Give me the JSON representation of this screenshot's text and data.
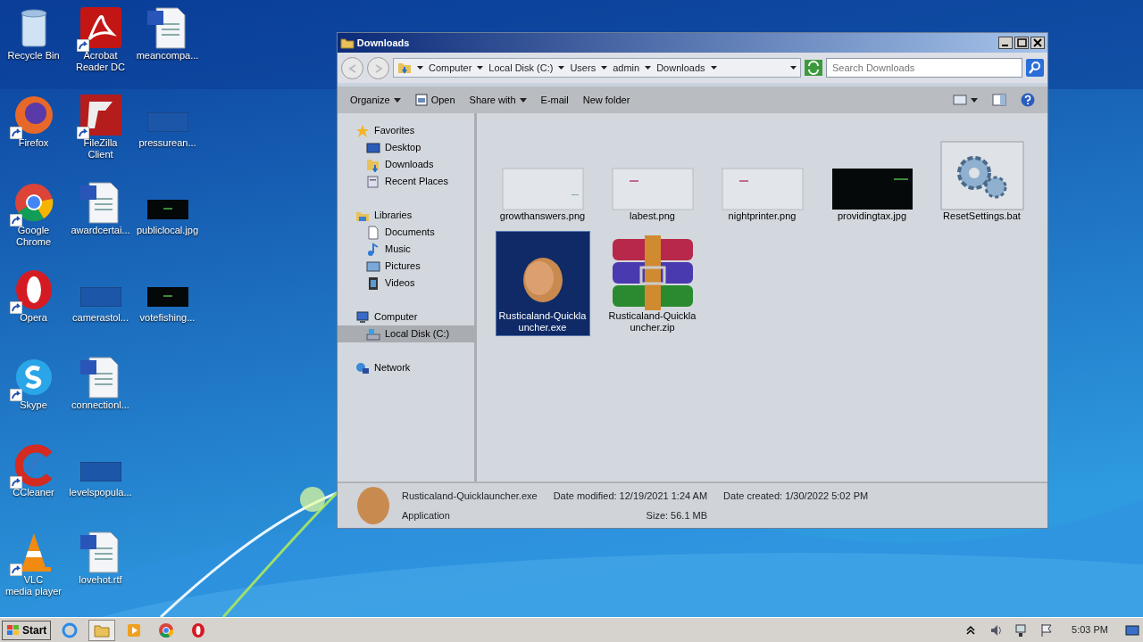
{
  "desktop": {
    "columns": [
      [
        {
          "label": "Recycle Bin",
          "kind": "recycle",
          "shortcut": false
        },
        {
          "label": "Firefox",
          "kind": "firefox",
          "shortcut": true
        },
        {
          "label": "Google Chrome",
          "kind": "chrome",
          "shortcut": true
        },
        {
          "label": "Opera",
          "kind": "opera",
          "shortcut": true
        },
        {
          "label": "Skype",
          "kind": "skype",
          "shortcut": true
        },
        {
          "label": "CCleaner",
          "kind": "ccleaner",
          "shortcut": true
        },
        {
          "label": "VLC media player",
          "kind": "vlc",
          "shortcut": true
        }
      ],
      [
        {
          "label": "Acrobat Reader DC",
          "kind": "acrobat",
          "shortcut": true
        },
        {
          "label": "FileZilla Client",
          "kind": "filezilla",
          "shortcut": true
        },
        {
          "label": "awardcertai...",
          "kind": "word",
          "shortcut": false
        },
        {
          "label": "camerastol...",
          "kind": "blank",
          "shortcut": false
        },
        {
          "label": "connectionl...",
          "kind": "word",
          "shortcut": false
        },
        {
          "label": "levelspopula...",
          "kind": "blank",
          "shortcut": false
        },
        {
          "label": "lovehot.rtf",
          "kind": "word",
          "shortcut": false
        }
      ],
      [
        {
          "label": "meancompa...",
          "kind": "word",
          "shortcut": false
        },
        {
          "label": "pressurean...",
          "kind": "blank",
          "shortcut": false
        },
        {
          "label": "publiclocal.jpg",
          "kind": "dark",
          "shortcut": false
        },
        {
          "label": "votefishing...",
          "kind": "dark",
          "shortcut": false
        }
      ]
    ]
  },
  "window": {
    "title": "Downloads",
    "address": [
      "Computer",
      "Local Disk (C:)",
      "Users",
      "admin",
      "Downloads"
    ],
    "search": {
      "placeholder": "Search Downloads"
    },
    "toolbar": [
      {
        "label": "Organize",
        "dropdown": true,
        "kind": "menu"
      },
      {
        "label": "Open",
        "dropdown": false,
        "kind": "open"
      },
      {
        "label": "Share with",
        "dropdown": true,
        "kind": "menu"
      },
      {
        "label": "E-mail",
        "dropdown": false,
        "kind": "plain"
      },
      {
        "label": "New folder",
        "dropdown": false,
        "kind": "plain"
      }
    ],
    "nav": [
      {
        "label": "Favorites",
        "kind": "star",
        "selected": false,
        "children": [
          {
            "label": "Desktop",
            "kind": "desktop",
            "selected": false
          },
          {
            "label": "Downloads",
            "kind": "downloads",
            "selected": false
          },
          {
            "label": "Recent Places",
            "kind": "recent",
            "selected": false
          }
        ]
      },
      {
        "label": "Libraries",
        "kind": "library",
        "selected": false,
        "children": [
          {
            "label": "Documents",
            "kind": "doc",
            "selected": false
          },
          {
            "label": "Music",
            "kind": "music",
            "selected": false
          },
          {
            "label": "Pictures",
            "kind": "pictures",
            "selected": false
          },
          {
            "label": "Videos",
            "kind": "videos",
            "selected": false
          }
        ]
      },
      {
        "label": "Computer",
        "kind": "computer",
        "selected": false,
        "children": [
          {
            "label": "Local Disk (C:)",
            "kind": "disk",
            "selected": true
          }
        ]
      },
      {
        "label": "Network",
        "kind": "network",
        "selected": false
      }
    ],
    "files": [
      {
        "name": "growthanswers.png",
        "kind": "light",
        "selected": false
      },
      {
        "name": "labest.png",
        "kind": "pink",
        "selected": false
      },
      {
        "name": "nightprinter.png",
        "kind": "pink",
        "selected": false
      },
      {
        "name": "providingtax.jpg",
        "kind": "dark",
        "selected": false
      },
      {
        "name": "ResetSettings.bat",
        "kind": "gear",
        "selected": false
      },
      {
        "name": "Rusticaland-Quicklauncher.exe",
        "kind": "exe",
        "selected": true
      },
      {
        "name": "Rusticaland-Quicklauncher.zip",
        "kind": "archive",
        "selected": false
      }
    ],
    "details": {
      "name": "Rusticaland-Quicklauncher.exe",
      "type": "Application",
      "modified_label": "Date modified:",
      "modified": "12/19/2021 1:24 AM",
      "size_label": "Size:",
      "size": "56.1 MB",
      "created_label": "Date created:",
      "created": "1/30/2022 5:02 PM"
    }
  },
  "taskbar": {
    "start": "Start",
    "apps": [
      {
        "kind": "ie",
        "selected": false
      },
      {
        "kind": "explorer",
        "selected": true
      },
      {
        "kind": "media",
        "selected": false
      },
      {
        "kind": "chrome",
        "selected": false
      },
      {
        "kind": "opera",
        "selected": false
      }
    ],
    "time": "5:03 PM"
  }
}
